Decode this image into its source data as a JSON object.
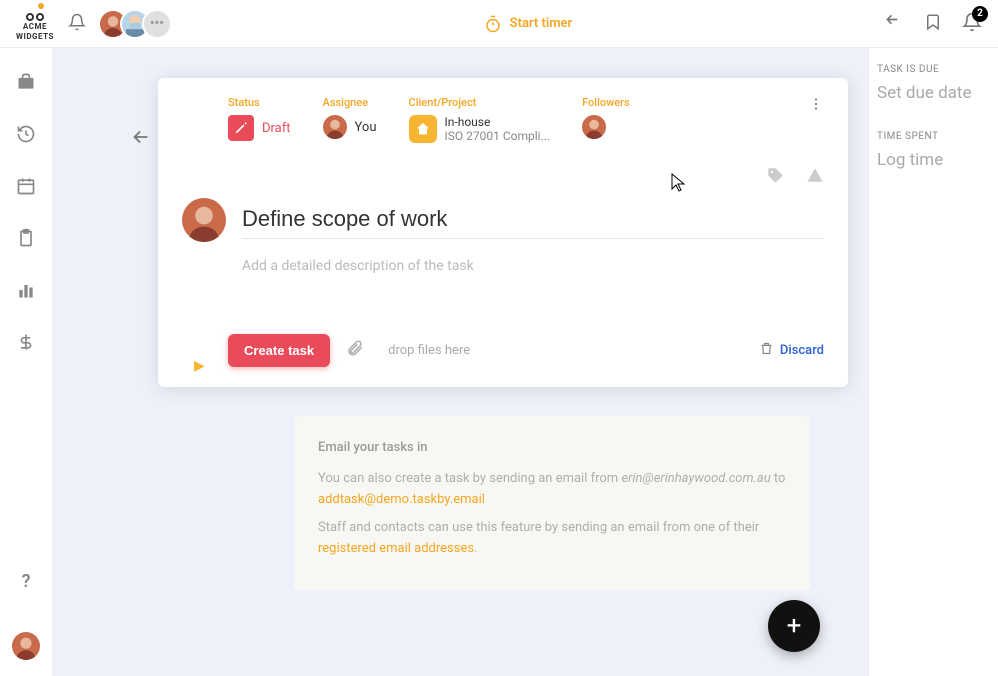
{
  "app": {
    "brand_line1": "ACME",
    "brand_line2": "WIDGETS",
    "timer_label": "Start timer",
    "notif_count": "2"
  },
  "sidebar": {
    "help_label": "?"
  },
  "task": {
    "meta": {
      "status_lbl": "Status",
      "status_val": "Draft",
      "assignee_lbl": "Assignee",
      "assignee_val": "You",
      "project_lbl": "Client/Project",
      "project_top": "In-house",
      "project_bot": "ISO 27001 Compli...",
      "followers_lbl": "Followers"
    },
    "title": "Define scope of work",
    "desc_placeholder": "Add a detailed description of the task",
    "create_btn": "Create task",
    "drop_text": "drop files here",
    "discard": "Discard"
  },
  "email_card": {
    "title": "Email your tasks in",
    "line1_pre": "You can also create a task by sending an email from ",
    "line1_em": "erin@erinhaywood.com.au",
    "line1_post": " to ",
    "link1": "addtask@demo.taskby.email",
    "line2": "Staff and contacts can use this feature by sending an email from one of their ",
    "link2": "registered email addresses",
    "suffix": "."
  },
  "right": {
    "due_lbl": "TASK IS DUE",
    "due_val": "Set due date",
    "time_lbl": "TIME SPENT",
    "time_val": "Log time"
  }
}
